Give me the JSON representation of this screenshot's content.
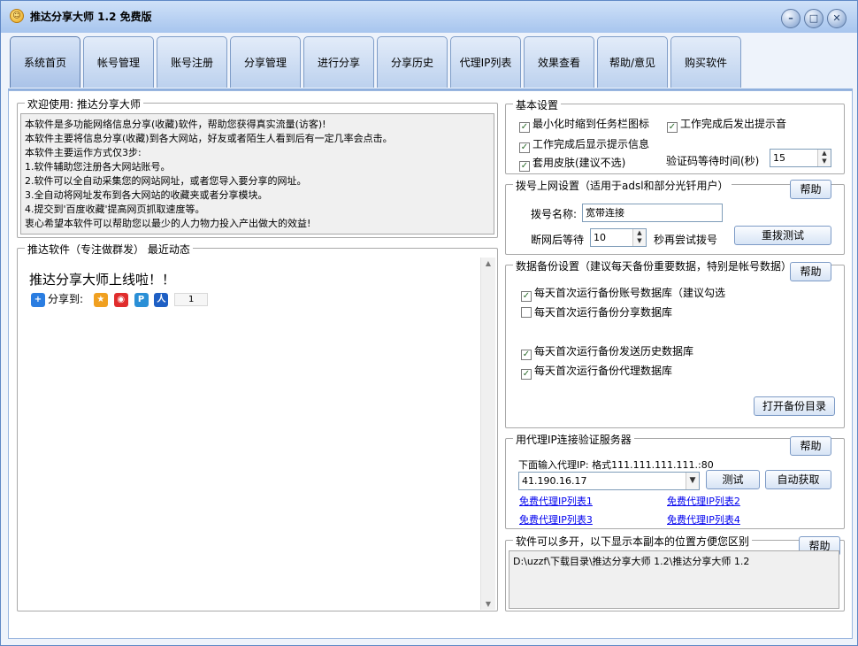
{
  "window": {
    "title": "推达分享大师 1.2 免费版"
  },
  "tabs": [
    "系统首页",
    "帐号管理",
    "账号注册",
    "分享管理",
    "进行分享",
    "分享历史",
    "代理IP列表",
    "效果查看",
    "帮助/意见",
    "购买软件"
  ],
  "welcome": {
    "title": "欢迎使用: 推达分享大师",
    "lines": [
      "本软件是多功能网络信息分享(收藏)软件，帮助您获得真实流量(访客)!",
      "本软件主要将信息分享(收藏)到各大网站，好友或者陌生人看到后有一定几率会点击。",
      "本软件主要运作方式仅3步:",
      "1.软件辅助您注册各大网站账号。",
      "2.软件可以全自动采集您的网站网址，或者您导入要分享的网址。",
      "3.全自动将网址发布到各大网站的收藏夹或者分享模块。",
      "4.提交到'百度收藏'提高网页抓取速度等。",
      "衷心希望本软件可以帮助您以最少的人力物力投入产出做大的效益!"
    ]
  },
  "news": {
    "title": "推达软件（专注做群发） 最近动态",
    "headline": "推达分享大师上线啦！！",
    "share_label": "分享到:",
    "share_count": "1"
  },
  "basic": {
    "title": "基本设置",
    "cb1": "最小化时缩到任务栏图标",
    "cb2": "工作完成后发出提示音",
    "cb3": "工作完成后显示提示信息",
    "cb4": "套用皮肤(建议不选)",
    "captcha_label": "验证码等待时间(秒)",
    "captcha_value": "15"
  },
  "dial": {
    "title": "拨号上网设置（适用于adsl和部分光钎用户）",
    "help": "帮助",
    "name_label": "拨号名称:",
    "name_value": "宽带连接",
    "wait_label": "断网后等待",
    "wait_value": "10",
    "retry_label": "秒再尝试拨号",
    "redial_button": "重拨测试"
  },
  "backup": {
    "title": "数据备份设置（建议每天备份重要数据，特别是帐号数据）",
    "help": "帮助",
    "cb1": "每天首次运行备份账号数据库（建议勾选",
    "cb2": "每天首次运行备份分享数据库",
    "cb3": "每天首次运行备份发送历史数据库",
    "cb4": "每天首次运行备份代理数据库",
    "open_button": "打开备份目录"
  },
  "proxy": {
    "title": "用代理IP连接验证服务器",
    "help": "帮助",
    "label": "下面输入代理IP: 格式111.111.111.111.:80",
    "value": "41.190.16.17",
    "test_button": "测试",
    "auto_button": "自动获取",
    "links": [
      "免费代理IP列表1",
      "免费代理IP列表2",
      "免费代理IP列表3",
      "免费代理IP列表4"
    ]
  },
  "path": {
    "title": "软件可以多开，以下显示本副本的位置方便您区别",
    "help": "帮助",
    "value": "D:\\uzzf\\下载目录\\推达分享大师 1.2\\推达分享大师 1.2"
  }
}
